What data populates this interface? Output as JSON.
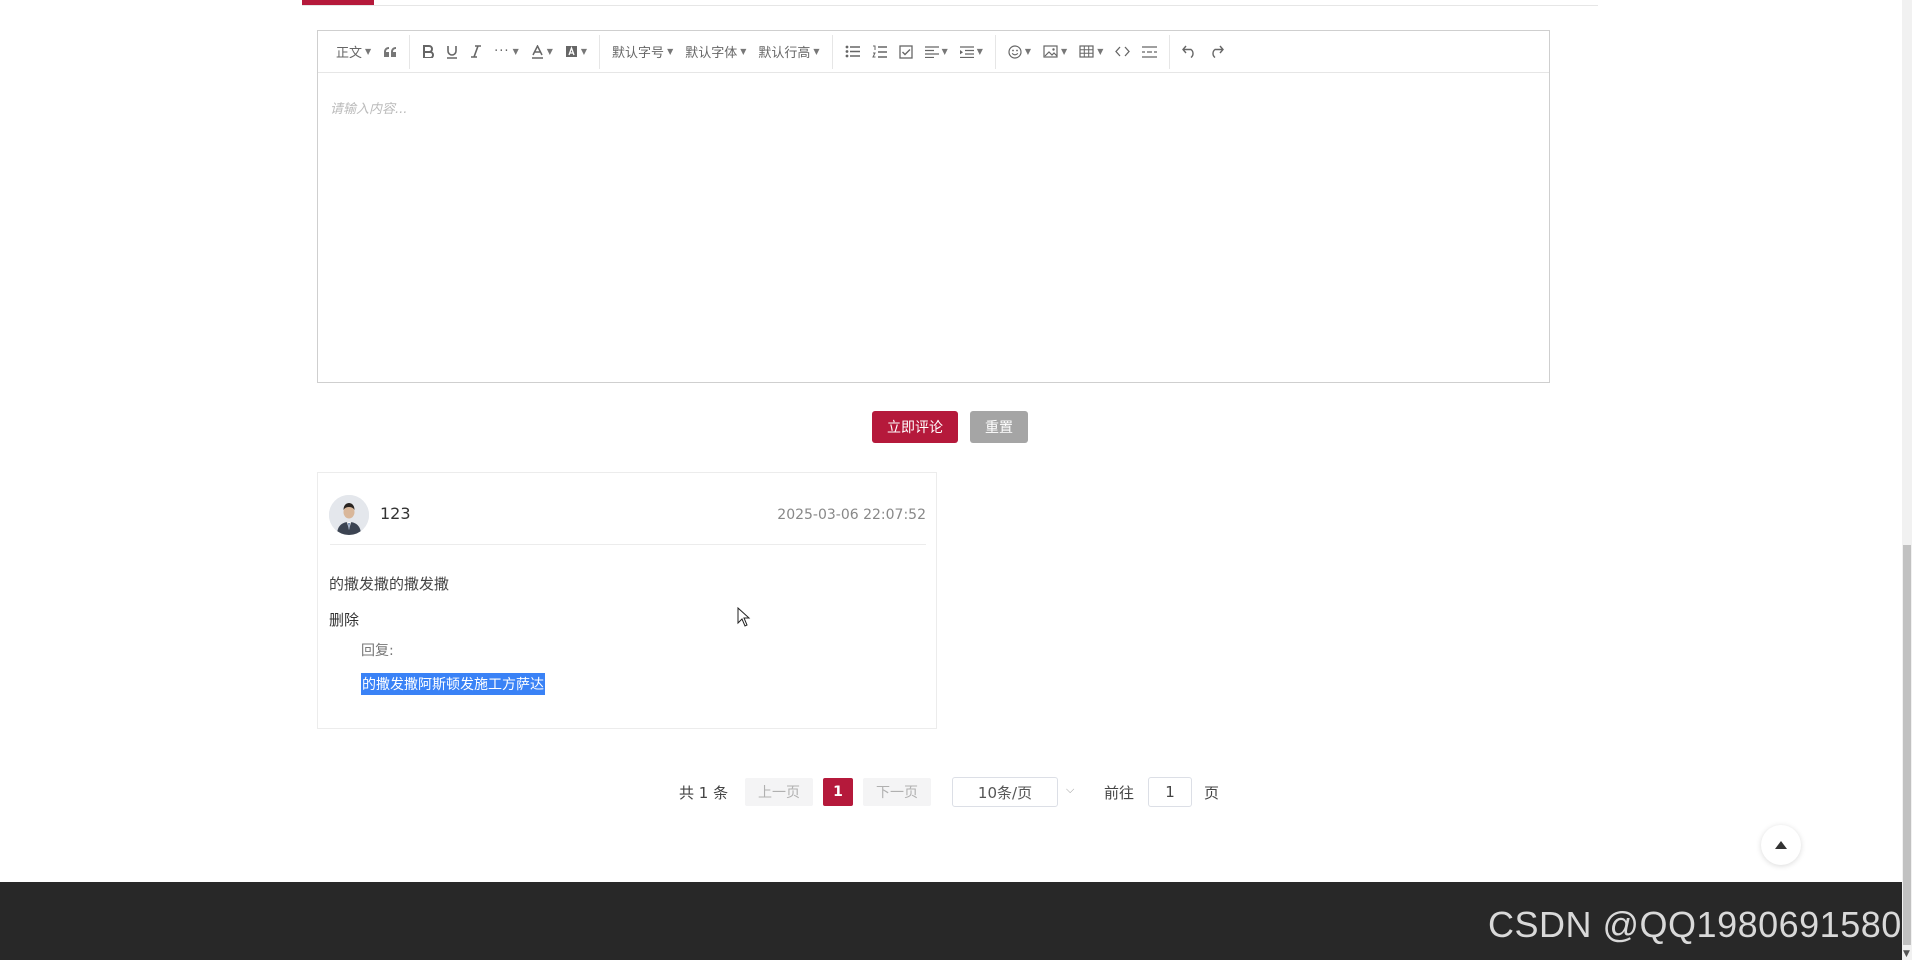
{
  "editor": {
    "toolbar": {
      "paragraph_style": "正文",
      "font_size": "默认字号",
      "font_family": "默认字体",
      "line_height": "默认行高"
    },
    "placeholder": "请输入内容..."
  },
  "actions": {
    "submit_label": "立即评论",
    "reset_label": "重置"
  },
  "comment": {
    "username": "123",
    "timestamp": "2025-03-06 22:07:52",
    "content": "的撒发撒的撒发撒",
    "delete_label": "删除",
    "reply_label": "回复:",
    "reply_text": "的撒发撒阿斯顿发施工方萨达"
  },
  "pagination": {
    "total": "共 1 条",
    "prev_label": "上一页",
    "current_page": "1",
    "next_label": "下一页",
    "page_size": "10条/页",
    "goto_label": "前往",
    "goto_value": "1",
    "page_unit": "页"
  },
  "watermark": "CSDN @QQ1980691580",
  "colors": {
    "primary": "#b5193b",
    "reset": "#a5a5a5",
    "footer": "#282828",
    "selection": "#3a82f6"
  }
}
